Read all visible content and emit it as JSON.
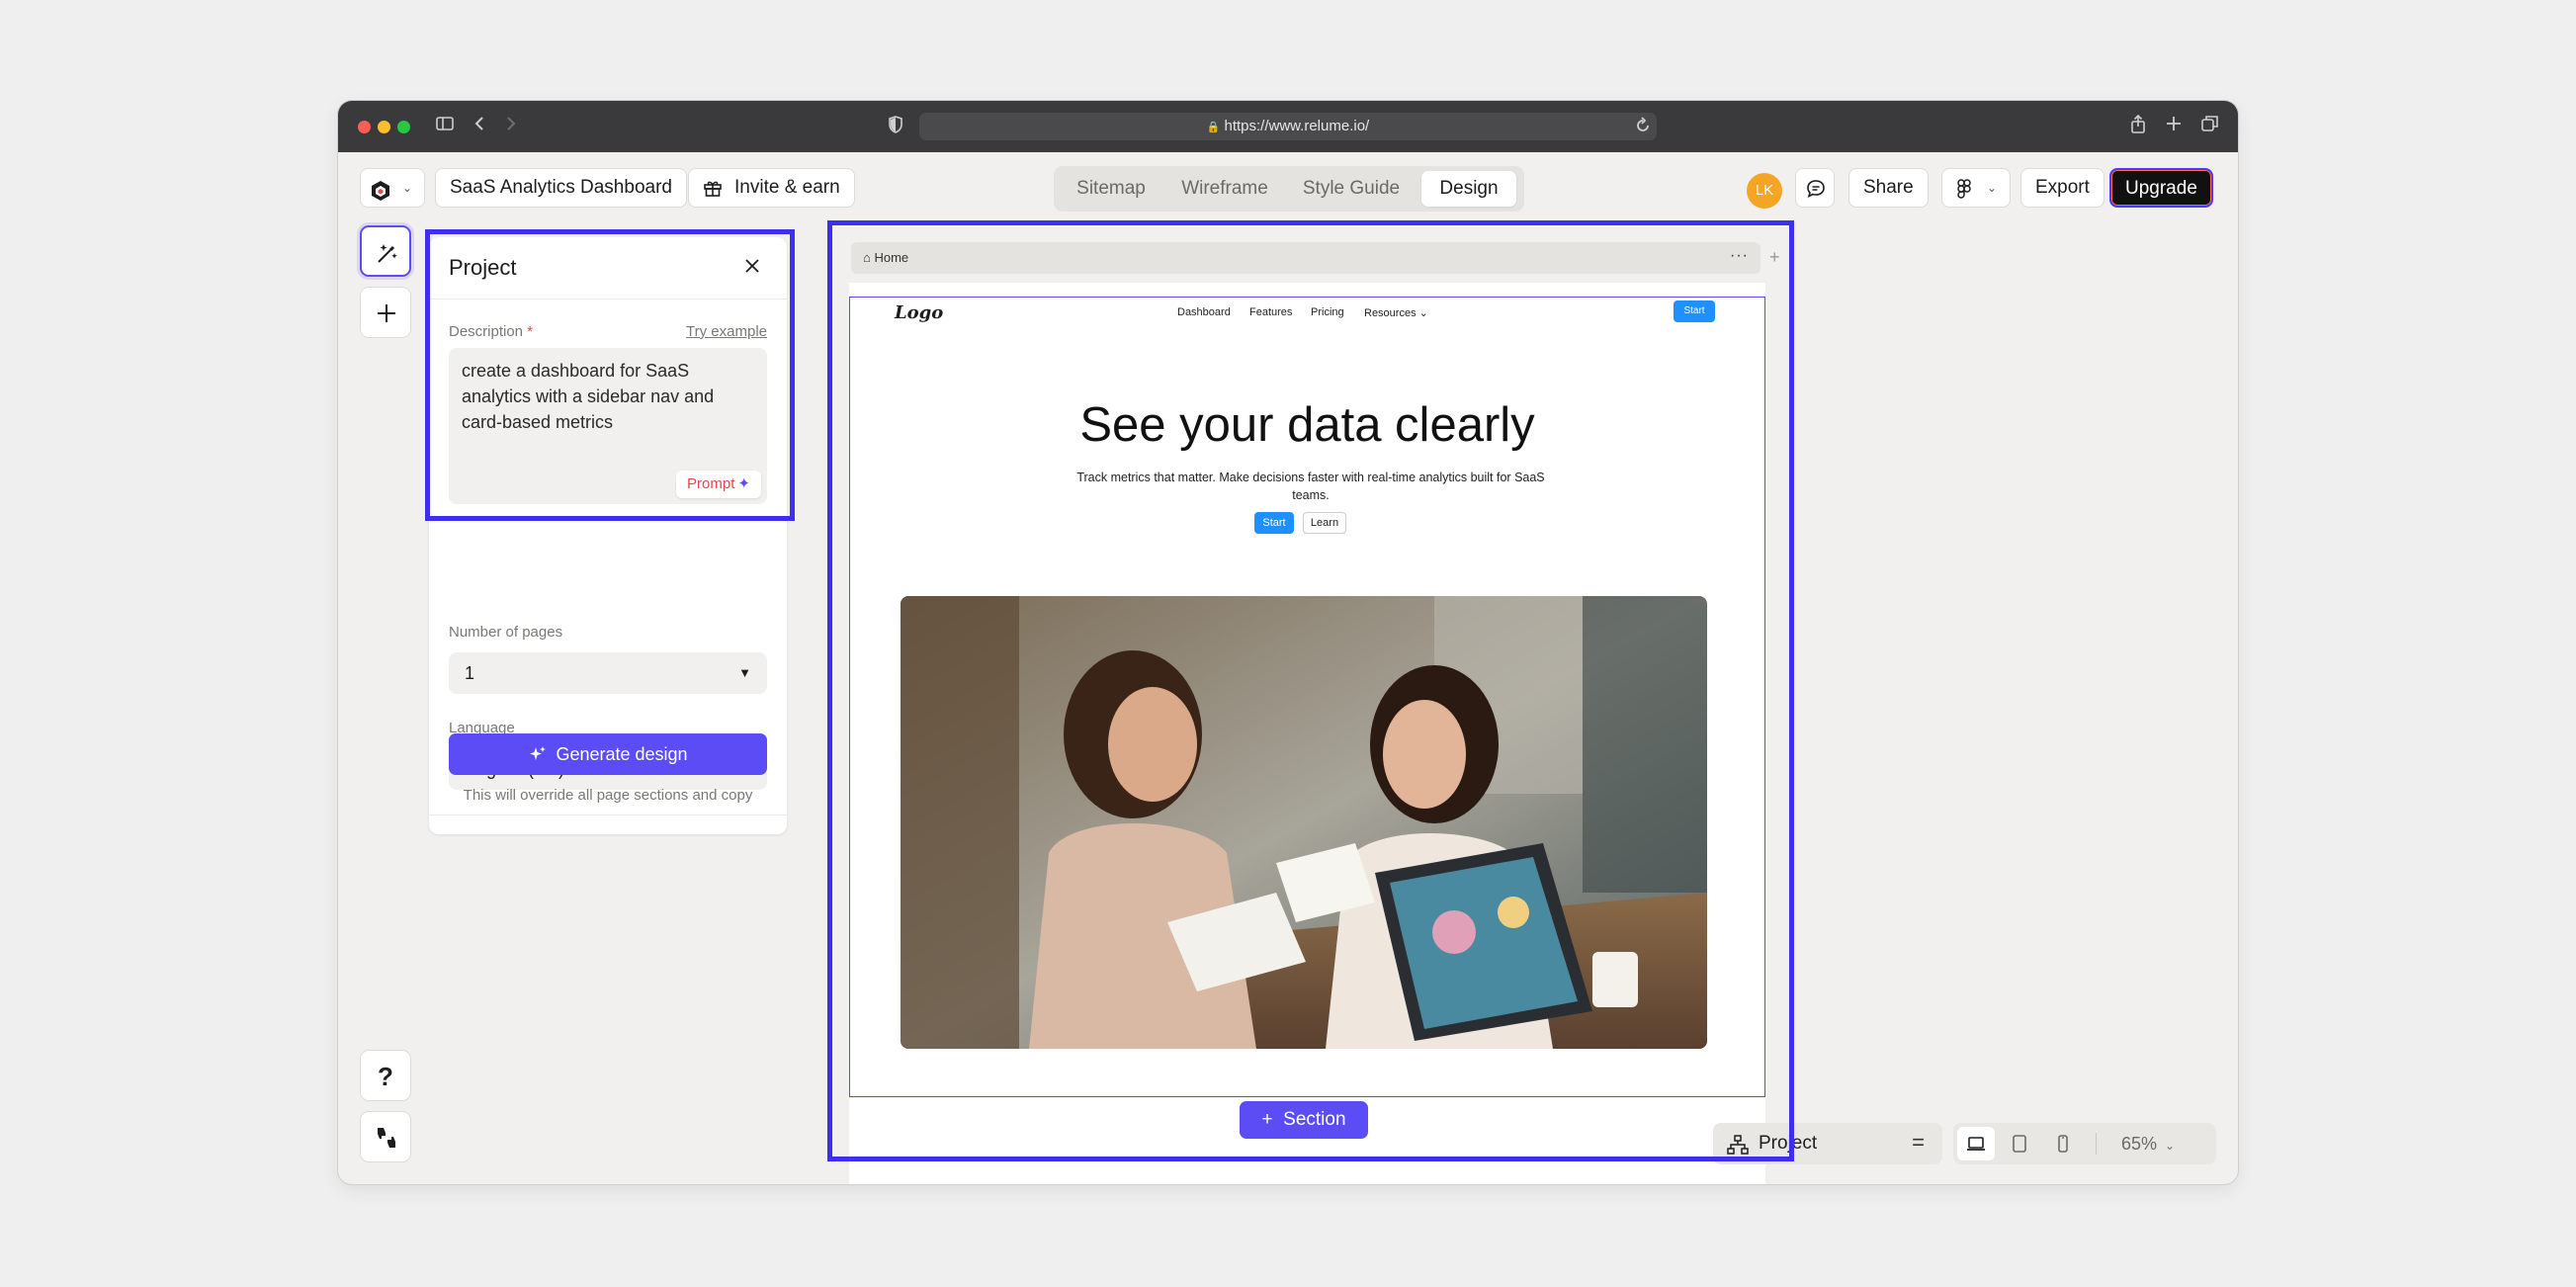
{
  "browser": {
    "url": "https://www.relume.io/"
  },
  "toolbar": {
    "project_title": "SaaS Analytics Dashboard",
    "invite_label": "Invite & earn",
    "tabs": [
      {
        "label": "Sitemap",
        "active": false
      },
      {
        "label": "Wireframe",
        "active": false
      },
      {
        "label": "Style Guide",
        "active": false
      },
      {
        "label": "Design",
        "active": true
      }
    ],
    "avatar_initials": "LK",
    "share_label": "Share",
    "export_label": "Export",
    "upgrade_label": "Upgrade"
  },
  "rail": {
    "help_label": "?"
  },
  "panel": {
    "title": "Project",
    "description_label": "Description",
    "required_mark": "*",
    "try_example": "Try example",
    "description_value": "create a dashboard for SaaS analytics with a sidebar nav and card-based metrics",
    "prompt_label": "Prompt",
    "pages_label": "Number of pages",
    "pages_value": "1",
    "language_label": "Language",
    "language_value": "English (US)",
    "generate_label": "Generate design",
    "override_note": "This will override all page sections and copy"
  },
  "canvas": {
    "page_name": "Home",
    "site": {
      "logo": "Logo",
      "nav": [
        "Dashboard",
        "Features",
        "Pricing",
        "Resources"
      ],
      "nav_cta": "Start",
      "hero_title": "See your data clearly",
      "hero_subtitle": "Track metrics that matter. Make decisions faster with real-time analytics built for SaaS teams.",
      "hero_primary": "Start",
      "hero_secondary": "Learn"
    },
    "section_button": "Section"
  },
  "bottom": {
    "project_label": "Project",
    "zoom": "65%"
  },
  "colors": {
    "accent": "#5b4cf5",
    "highlight": "#3d2ef0",
    "site_primary": "#1e90ff",
    "avatar": "#f5a524"
  }
}
